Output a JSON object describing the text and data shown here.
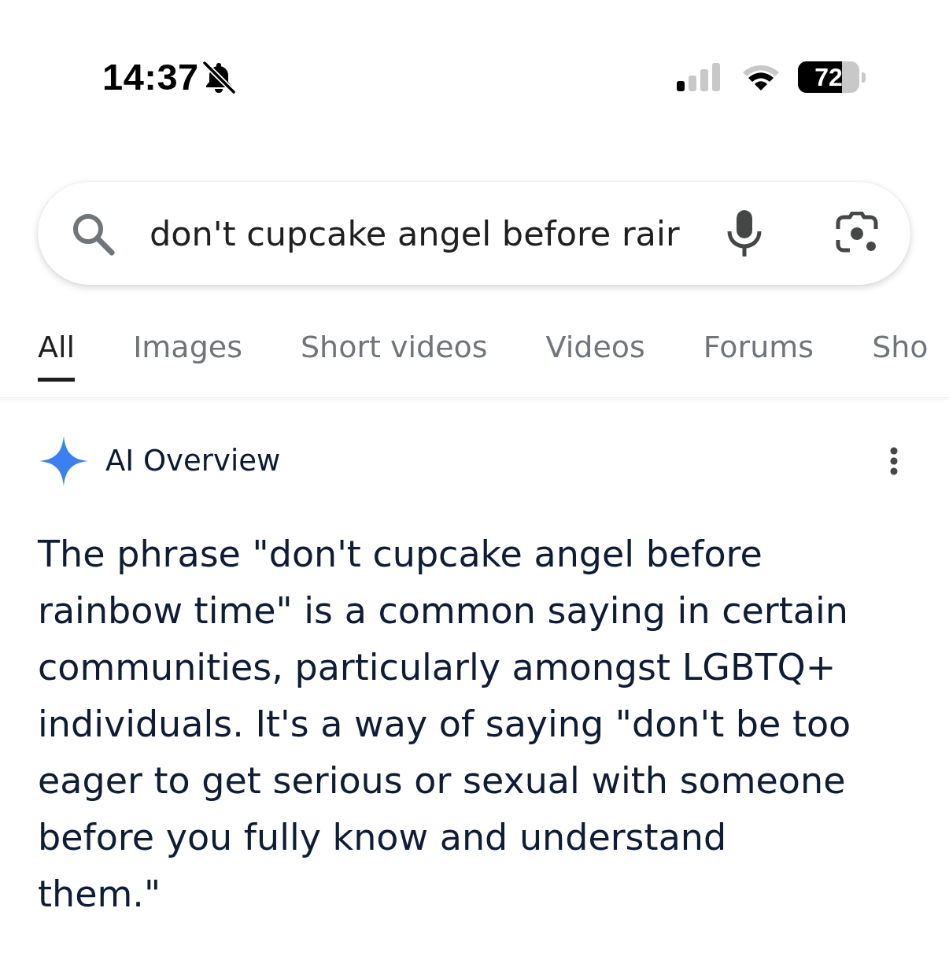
{
  "status_bar": {
    "time": "14:37",
    "battery": "72"
  },
  "search": {
    "value": "don't cupcake angel before rair"
  },
  "tabs": [
    {
      "label": "All",
      "selected": true
    },
    {
      "label": "Images",
      "selected": false
    },
    {
      "label": "Short videos",
      "selected": false
    },
    {
      "label": "Videos",
      "selected": false
    },
    {
      "label": "Forums",
      "selected": false
    },
    {
      "label": "Sho",
      "selected": false
    }
  ],
  "ai_overview": {
    "title": "AI Overview",
    "text": "The phrase \"don't cupcake angel before rainbow time\" is a common saying in certain communities, particularly amongst LGBTQ+ individuals. It's a way of saying \"don't be too eager to get serious or sexual with someone before you fully know and understand them.\""
  }
}
